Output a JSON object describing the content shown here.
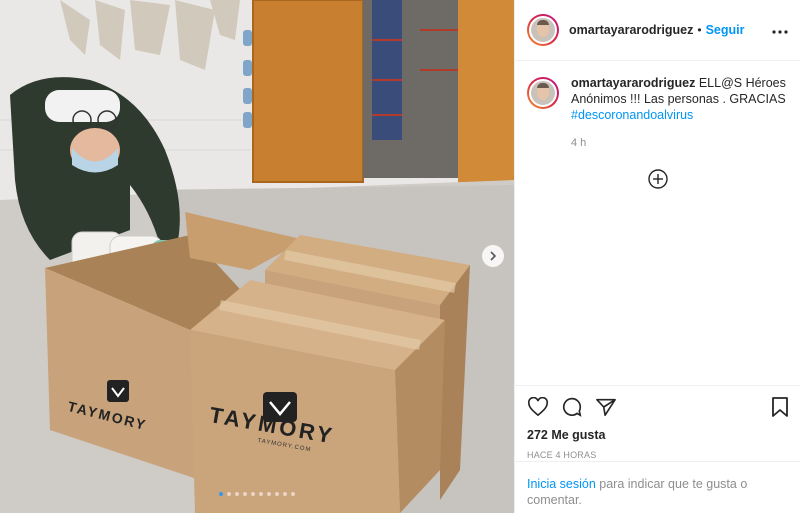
{
  "post": {
    "username": "omartayararodriguez",
    "separator": "•",
    "follow_label": "Seguir",
    "more_label": "•••",
    "caption_username": "omartayararodriguez",
    "caption_text": " ELL@S Héroes Anónimos !!! Las personas . GRACIAS ",
    "hashtag": "#descoronandoalvirus",
    "caption_time": "4 h",
    "likes": "272 Me gusta",
    "timestamp": "HACE 4 HORAS"
  },
  "photo": {
    "box_brand": "TAYMORY",
    "box_url": "TAYMORY.COM",
    "carousel_count": 10,
    "carousel_active_index": 0
  },
  "login": {
    "link": "Inicia sesión",
    "rest": " para indicar que te gusta o comentar."
  },
  "icons": {
    "more": "more-options-icon",
    "add": "add-comment-circle-icon",
    "like": "heart-icon",
    "comment": "comment-bubble-icon",
    "share": "paper-plane-icon",
    "save": "bookmark-icon",
    "next": "chevron-right-icon"
  },
  "colors": {
    "follow_blue": "#0095f6",
    "muted_gray": "#8e8e8e",
    "box_cardboard": "#c8a27a"
  }
}
